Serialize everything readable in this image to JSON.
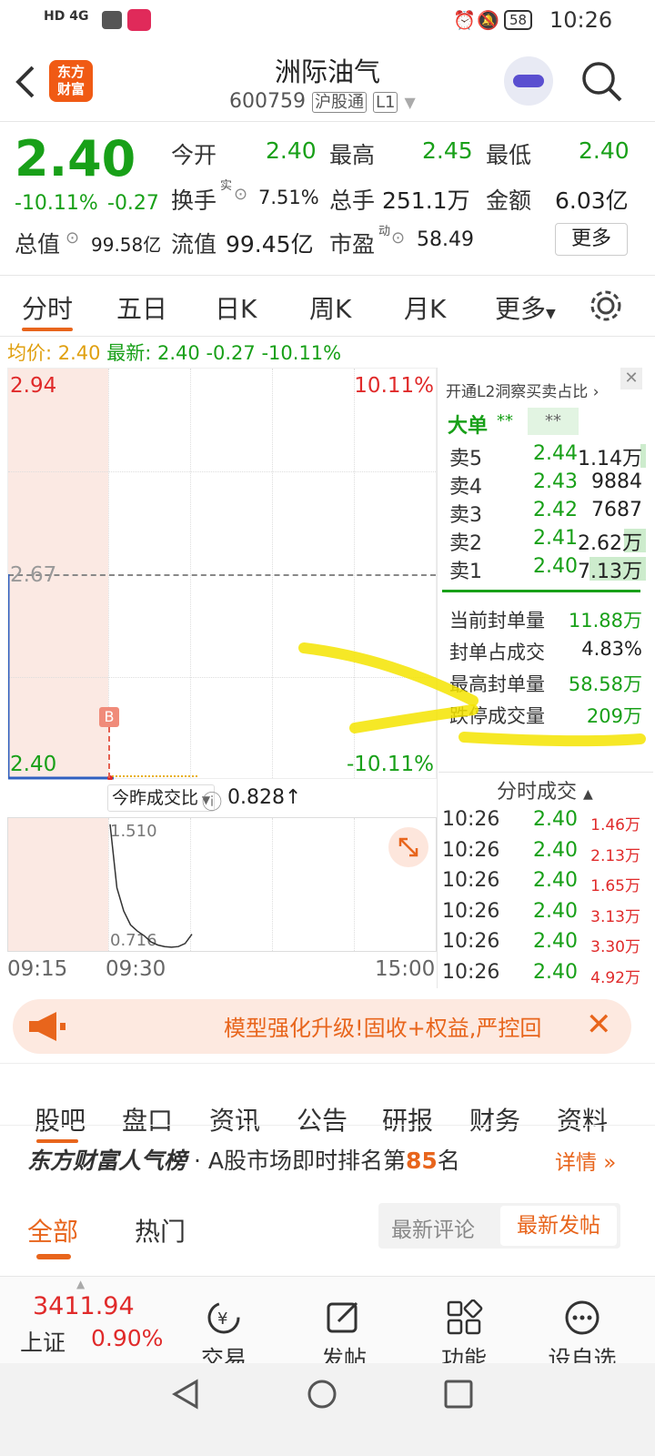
{
  "status_bar": {
    "left_icons": "HD 4G",
    "battery": "58",
    "time": "10:26"
  },
  "header": {
    "logo_text_1": "东方",
    "logo_text_2": "财富",
    "stock_name": "洲际油气",
    "stock_code": "600759",
    "market_badge": "沪股通",
    "level_badge": "L1"
  },
  "quote": {
    "price": "2.40",
    "change_pct": "-10.11%",
    "change_abs": "-0.27",
    "open_label": "今开",
    "open": "2.40",
    "high_label": "最高",
    "high": "2.45",
    "low_label": "最低",
    "low": "2.40",
    "turnover_label": "换手",
    "turnover_sup": "实",
    "turnover": "7.51%",
    "volume_label": "总手",
    "volume": "251.1万",
    "amount_label": "金额",
    "amount": "6.03亿",
    "mktcap_label": "总值",
    "mktcap": "99.58亿",
    "float_label": "流值",
    "float_cap": "99.45亿",
    "pe_label": "市盈",
    "pe_sup": "动",
    "pe": "58.49",
    "more_button": "更多"
  },
  "chart_tabs": [
    "分时",
    "五日",
    "日K",
    "周K",
    "月K",
    "更多"
  ],
  "chart_info": {
    "avg_label": "均价:",
    "avg": "2.40",
    "latest_label": "最新:",
    "latest": "2.40",
    "chg": "-0.27",
    "pct": "-10.11%"
  },
  "chart_data": {
    "type": "line",
    "y_top_label": "2.94",
    "y_mid_label": "2.67",
    "y_bottom_label": "2.40",
    "pct_top_label": "10.11%",
    "pct_bottom_label": "-10.11%",
    "ylim": [
      2.4,
      2.94
    ],
    "x_ticks": [
      "09:15",
      "09:30",
      "15:00"
    ],
    "buy_marker": "B",
    "series": [
      {
        "x": [
          "09:15",
          "09:30",
          "09:31"
        ],
        "values": [
          2.67,
          2.4,
          2.4
        ]
      }
    ],
    "sub_chart": {
      "selector": "今昨成交比",
      "value": "0.828",
      "arrow": "↑",
      "y_top": "1.510",
      "y_bottom": "0.716",
      "values": [
        1.51,
        1.1,
        0.95,
        0.86,
        0.82,
        0.79,
        0.75,
        0.73,
        0.72,
        0.716,
        0.72,
        0.74,
        0.8
      ]
    }
  },
  "order_book": {
    "banner": "开通L2洞察买卖占比",
    "big_order_label": "大单",
    "big_a": "**",
    "big_b": "**",
    "asks": [
      {
        "label": "卖5",
        "price": "2.44",
        "vol": "1.14万"
      },
      {
        "label": "卖4",
        "price": "2.43",
        "vol": "9884"
      },
      {
        "label": "卖3",
        "price": "2.42",
        "vol": "7687"
      },
      {
        "label": "卖2",
        "price": "2.41",
        "vol": "2.62万"
      },
      {
        "label": "卖1",
        "price": "2.40",
        "vol": "7.13万"
      }
    ],
    "stats": [
      {
        "label": "当前封单量",
        "value": "11.88万"
      },
      {
        "label": "封单占成交",
        "value": "4.83%"
      },
      {
        "label": "最高封单量",
        "value": "58.58万"
      },
      {
        "label": "跌停成交量",
        "value": "209万"
      }
    ]
  },
  "ticks": {
    "title": "分时成交",
    "rows": [
      {
        "time": "10:26",
        "price": "2.40",
        "vol": "1.46万"
      },
      {
        "time": "10:26",
        "price": "2.40",
        "vol": "2.13万"
      },
      {
        "time": "10:26",
        "price": "2.40",
        "vol": "1.65万"
      },
      {
        "time": "10:26",
        "price": "2.40",
        "vol": "3.13万"
      },
      {
        "time": "10:26",
        "price": "2.40",
        "vol": "3.30万"
      },
      {
        "time": "10:26",
        "price": "2.40",
        "vol": "4.92万"
      }
    ]
  },
  "promo": {
    "text": "模型强化升级!固收+权益,严控回"
  },
  "section_tabs": [
    "股吧",
    "盘口",
    "资讯",
    "公告",
    "研报",
    "财务",
    "资料"
  ],
  "rank": {
    "title": "东方财富人气榜",
    "text_pre": "· A股市场即时排名第",
    "rank": "85",
    "text_post": "名",
    "detail": "详情"
  },
  "forum_tabs": {
    "all": "全部",
    "hot": "热门",
    "latest_comment": "最新评论",
    "latest_post": "最新发帖"
  },
  "bottom_nav": {
    "index_value": "3411.94",
    "index_name": "上证",
    "index_pct": "0.90%",
    "items": [
      {
        "label": "交易",
        "icon": "yen-exchange-icon"
      },
      {
        "label": "发帖",
        "icon": "edit-icon"
      },
      {
        "label": "功能",
        "icon": "grid-icon"
      },
      {
        "label": "设自选",
        "icon": "more-circle-icon"
      }
    ]
  },
  "colors": {
    "red": "#e02a2a",
    "green": "#18a018",
    "orange": "#e8651c",
    "highlight": "#f5e400"
  }
}
